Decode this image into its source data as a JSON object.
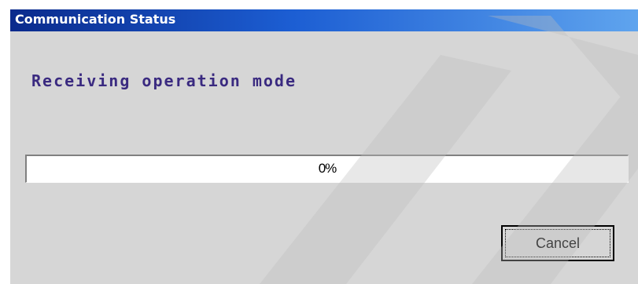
{
  "window": {
    "title": "Communication Status"
  },
  "status": {
    "message": "Receiving operation mode"
  },
  "progress": {
    "value": 0,
    "label": "0%"
  },
  "buttons": {
    "cancel_label": "Cancel"
  },
  "colors": {
    "title_bar_start": "#0a2a8c",
    "title_bar_end": "#5fa4ee",
    "dialog_background": "#d6d6d6",
    "status_text": "#3a2a80"
  }
}
